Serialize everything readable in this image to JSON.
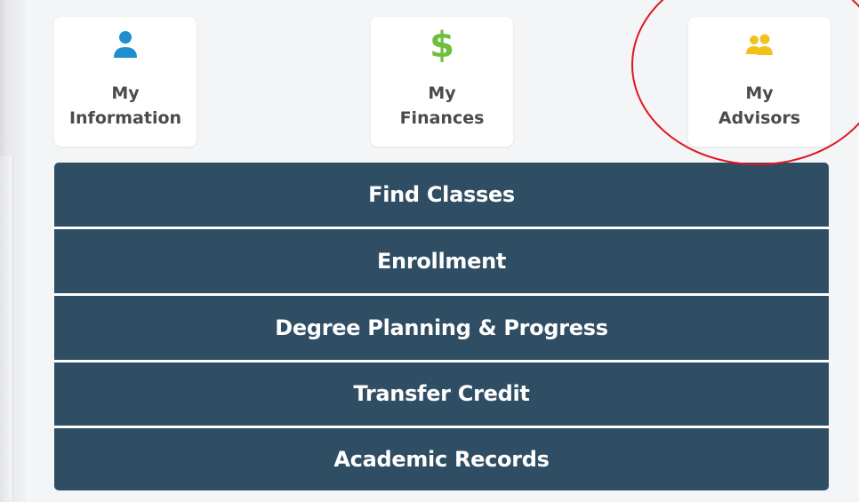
{
  "quick_links": [
    {
      "line1": "My",
      "line2": "Information",
      "icon": "person-icon",
      "color": "#1f8fcf"
    },
    {
      "line1": "My",
      "line2": "Finances",
      "icon": "dollar-icon",
      "color": "#6fbf3f"
    },
    {
      "line1": "My",
      "line2": "Advisors",
      "icon": "people-icon",
      "color": "#f2c21b"
    }
  ],
  "finances_symbol": "$",
  "menu": {
    "items": [
      "Find Classes",
      "Enrollment",
      "Degree Planning & Progress",
      "Transfer Credit",
      "Academic Records"
    ],
    "background": "#2f4d63"
  },
  "annotation_color": "#e0161f"
}
